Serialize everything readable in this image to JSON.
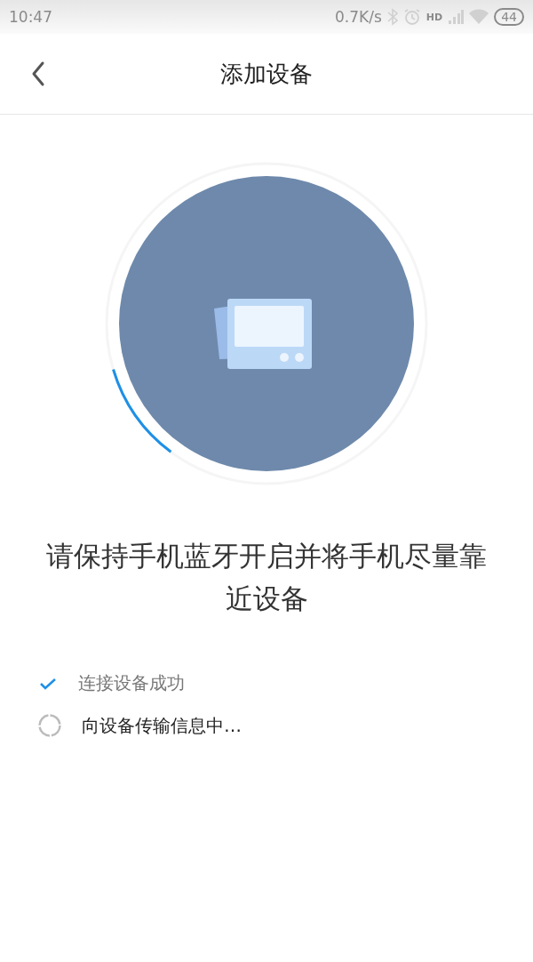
{
  "status_bar": {
    "time": "10:47",
    "speed": "0.7K/s",
    "signal_label": "HD",
    "battery": "44"
  },
  "header": {
    "title": "添加设备"
  },
  "message": "请保持手机蓝牙开启并将手机尽量靠近设备",
  "steps": [
    {
      "label": "连接设备成功",
      "done": true
    },
    {
      "label": "向设备传输信息中…",
      "done": false
    }
  ]
}
